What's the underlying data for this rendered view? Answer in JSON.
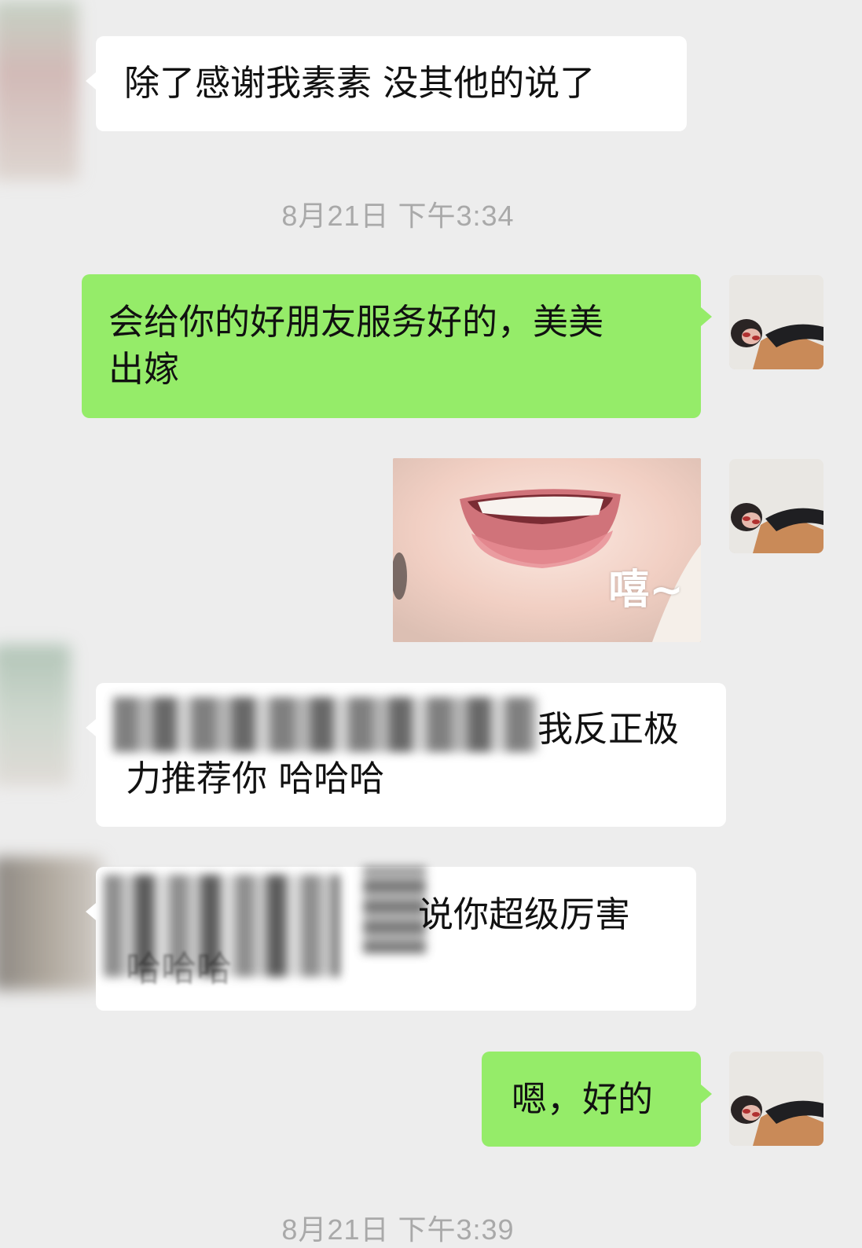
{
  "messages": [
    {
      "type": "incoming",
      "text": "除了感谢我素素 没其他的说了"
    },
    {
      "type": "timestamp",
      "text": "8月21日 下午3:34"
    },
    {
      "type": "outgoing",
      "text": "会给你的好朋友服务好的，美美\n出嫁"
    },
    {
      "type": "outgoing-sticker",
      "caption": "嘻~"
    },
    {
      "type": "incoming",
      "text_visible_end": "我反正极",
      "text_line2": "力推荐你 哈哈哈"
    },
    {
      "type": "incoming",
      "text_visible_end": "说你超级厉害",
      "text_line2": "哈哈哈"
    },
    {
      "type": "outgoing",
      "text": "嗯，好的"
    },
    {
      "type": "timestamp",
      "text": "8月21日 下午3:39"
    }
  ],
  "colors": {
    "background": "#ededed",
    "outgoing_bubble": "#95ec69",
    "incoming_bubble": "#ffffff",
    "timestamp_text": "#a9a9a9"
  },
  "icons": {
    "self_avatar": "avatar-person-lying-icon",
    "contact_avatar": "avatar-blurred-icon"
  }
}
